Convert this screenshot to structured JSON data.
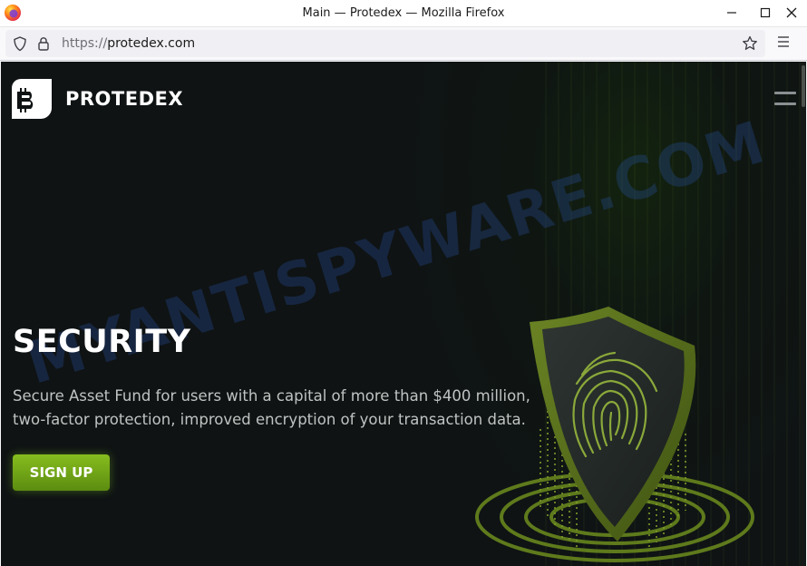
{
  "browser": {
    "window_title": "Main — Protedex — Mozilla Firefox",
    "url_protocol": "https://",
    "url_host": "protedex.com"
  },
  "site": {
    "brand": "PROTEDEX",
    "hero": {
      "title": "SECURITY",
      "text": "Secure Asset Fund for users with a capital of more than $400 million, two-factor protection, improved encryption of your transaction data.",
      "cta": "SIGN UP"
    },
    "watermark": "MYANTISPYWARE.COM"
  },
  "colors": {
    "accent": "#6fa315",
    "background": "#0f1314",
    "shield": "#596f1f"
  },
  "icons": {
    "browser_logo": "firefox-icon",
    "tracking": "shield-icon",
    "security": "lock-icon",
    "bookmark": "star-icon",
    "menu": "hamburger-icon"
  }
}
